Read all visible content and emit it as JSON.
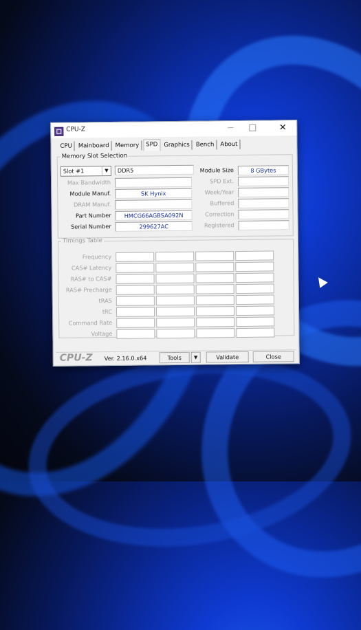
{
  "window": {
    "title": "CPU-Z",
    "controls": {
      "minimize": "—",
      "maximize": "",
      "close": "✕"
    }
  },
  "tabs": [
    "CPU",
    "Mainboard",
    "Memory",
    "SPD",
    "Graphics",
    "Bench",
    "About"
  ],
  "active_tab": "SPD",
  "memory_slot_selection": {
    "group_label": "Memory Slot Selection",
    "slot_selected": "Slot #1",
    "memory_type": "DDR5",
    "left_rows": [
      {
        "label": "Max Bandwidth",
        "value": ""
      },
      {
        "label": "Module Manuf.",
        "value": "SK Hynix"
      },
      {
        "label": "DRAM Manuf.",
        "value": ""
      },
      {
        "label": "Part Number",
        "value": "HMCG66AGBSA092N"
      },
      {
        "label": "Serial Number",
        "value": "299627AC"
      }
    ],
    "right_rows": [
      {
        "label": "Module Size",
        "value": "8 GBytes"
      },
      {
        "label": "SPD Ext.",
        "value": ""
      },
      {
        "label": "Week/Year",
        "value": ""
      },
      {
        "label": "Buffered",
        "value": ""
      },
      {
        "label": "Correction",
        "value": ""
      },
      {
        "label": "Registered",
        "value": ""
      }
    ]
  },
  "timings_table": {
    "group_label": "Timings Table",
    "rows": [
      "Frequency",
      "CAS# Latency",
      "RAS# to CAS#",
      "RAS# Precharge",
      "tRAS",
      "tRC",
      "Command Rate",
      "Voltage"
    ]
  },
  "footer": {
    "brand": "CPU-Z",
    "version": "Ver. 2.16.0.x64",
    "tools_label": "Tools",
    "validate_label": "Validate",
    "close_label": "Close"
  }
}
